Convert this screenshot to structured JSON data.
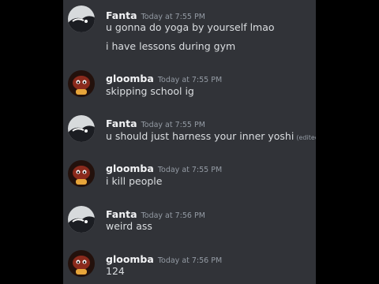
{
  "messages": [
    {
      "author": "Fanta",
      "avatar": "fanta-avatar",
      "time": "Today at 7:55 PM",
      "lines": [
        "u gonna do yoga by yourself lmao",
        "i have lessons during gym"
      ]
    },
    {
      "author": "gloomba",
      "avatar": "gloomba-avatar",
      "time": "Today at 7:55 PM",
      "lines": [
        "skipping school ig"
      ]
    },
    {
      "author": "Fanta",
      "avatar": "fanta-avatar",
      "time": "Today at 7:55 PM",
      "lines": [
        "u should just harness your inner yoshi"
      ],
      "edited_label": "(edited)"
    },
    {
      "author": "gloomba",
      "avatar": "gloomba-avatar",
      "time": "Today at 7:55 PM",
      "lines": [
        "i kill people"
      ]
    },
    {
      "author": "Fanta",
      "avatar": "fanta-avatar",
      "time": "Today at 7:56 PM",
      "lines": [
        "weird ass"
      ]
    },
    {
      "author": "gloomba",
      "avatar": "gloomba-avatar",
      "time": "Today at 7:56 PM",
      "lines": [
        "124"
      ]
    }
  ],
  "colors": {
    "chat_bg": "#313338",
    "username": "#f2f3f5",
    "text": "#dbdee1",
    "timestamp": "#949ba4"
  }
}
